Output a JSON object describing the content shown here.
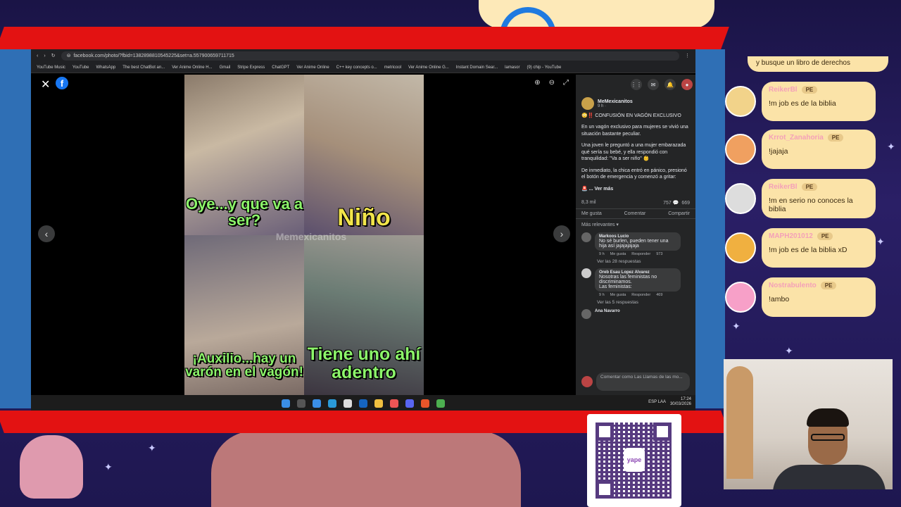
{
  "browser": {
    "url": "facebook.com/photo/?fbid=1382898810545225&set=a.557900659711715",
    "bookmarks": [
      "YouTube Music",
      "YouTube",
      "WhatsApp",
      "The best ChatBot an...",
      "Ver Anime Online H...",
      "Gmail",
      "Stripe Express",
      "ChatGPT",
      "Ver Anime Online",
      "C++ key concepts o...",
      "metricool",
      "Ver Anime Online G...",
      "Instant Domain Sear...",
      "lamasor",
      "(9) chip - YouTube"
    ]
  },
  "meme": {
    "panel1": "Oye...y que va a ser?",
    "panel2": "Niño",
    "panel3": "¡Auxilio...hay un varón en el vagón!",
    "panel4": "Tiene uno ahí adentro",
    "watermark": "Memexicanitos"
  },
  "post": {
    "author": "MeMexicanitos",
    "time": "9 h ·",
    "headline": "😳‼️ CONFUSIÓN EN VAGÓN EXCLUSIVO",
    "p1": "En un vagón exclusivo para mujeres se vivió una situación bastante peculiar.",
    "p2": "Una joven le preguntó a una mujer embarazada qué sería su bebé, y ella respondió con tranquilidad: \"Va a ser niño\" 👶",
    "p3": "De inmediato, la chica entró en pánico, presionó el botón de emergencia y comenzó a gritar:",
    "see_more": "🚨 ... Ver más",
    "reaction_count": "8,3 mil",
    "comments_count": "757",
    "shares_count": "669",
    "like_label": "Me gusta",
    "comment_label": "Comentar",
    "share_label": "Compartir",
    "filter": "Más relevantes ▾",
    "comments": [
      {
        "name": "Markoos Lucio",
        "text": "No sé burlen, pueden tener una hija así jajajajajaja",
        "time": "9 h",
        "like": "Me gusta",
        "reply": "Responder",
        "count": "973",
        "replies": "Ver las 28 respuestas"
      },
      {
        "name": "Oreb Esau Lopez Alvarez",
        "text": "Nosotras las feministas no discriminamos.",
        "extra": "Las feministas:",
        "time": "9 h",
        "like": "Me gusta",
        "reply": "Responder",
        "count": "469",
        "replies": "Ver las 5 respuestas"
      },
      {
        "name": "Ana Navarro"
      }
    ],
    "compose_placeholder": "Comentar como Las Llamas de las mo..."
  },
  "tray": {
    "lang": "ESP LAA",
    "time": "17:24",
    "date": "30/03/2026"
  },
  "chat": {
    "top_partial": "y busque un libro de derechos",
    "messages": [
      {
        "user": "ReikerBl",
        "badge": "PE",
        "msg": "!m job es de la biblia"
      },
      {
        "user": "Krrot_Zanahoria",
        "badge": "PE",
        "msg": "!jajaja"
      },
      {
        "user": "ReikerBl",
        "badge": "PE",
        "msg": "!m en serio no conoces la biblia"
      },
      {
        "user": "MAPH201012",
        "badge": "PE",
        "msg": "!m job es de la biblia xD"
      },
      {
        "user": "Nostrabulento",
        "badge": "PE",
        "msg": "!ambo"
      }
    ]
  },
  "qr": {
    "logo": "yape"
  },
  "colors": {
    "red_band": "#e31212",
    "meme_text": "#8cf56a",
    "fb_blue": "#1877f2",
    "chat_bubble": "#fbe3a8"
  }
}
